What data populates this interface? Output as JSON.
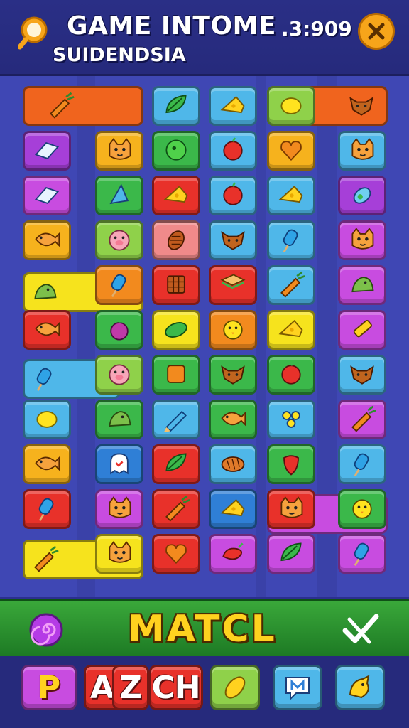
{
  "header": {
    "title": "GAME INTOME",
    "subtitle": "SUIDENDSIA",
    "timer": ".3:909"
  },
  "board": {
    "rows": [
      [
        {
          "color": "#4fb7e9",
          "icon": "leaf-icon"
        },
        {
          "color": "#4fb7e9",
          "icon": "cheese-icon"
        },
        {
          "color": "#8fd14a",
          "icon": "lemon-icon"
        }
      ],
      [
        {
          "color": "#a63fd8",
          "icon": "eraser-icon"
        },
        {
          "color": "#f6b21d",
          "icon": "cat-face-icon"
        },
        {
          "color": "#3bb84a",
          "icon": "melon-icon"
        },
        {
          "color": "#4fb7e9",
          "icon": "apple-icon"
        },
        {
          "color": "#f6b21d",
          "icon": "heart-icon"
        },
        {
          "color": "#4fb7e9",
          "icon": "cat-face-icon"
        }
      ],
      [
        {
          "color": "#c84ce0",
          "icon": "eraser-icon"
        },
        {
          "color": "#3bb84a",
          "icon": "cone-icon"
        },
        {
          "color": "#e8312a",
          "icon": "cheese-icon"
        },
        {
          "color": "#4fb7e9",
          "icon": "apple-icon"
        },
        {
          "color": "#4fb7e9",
          "icon": "cheese-icon"
        },
        {
          "color": "#a63fd8",
          "icon": "potion-icon"
        }
      ],
      [
        {
          "color": "#f6b21d",
          "icon": "fish-icon"
        },
        {
          "color": "#8fd14a",
          "icon": "pig-face-icon"
        },
        {
          "color": "#f08a8a",
          "icon": "pinecone-icon"
        },
        {
          "color": "#4fb7e9",
          "icon": "fox-face-icon"
        },
        {
          "color": "#4fb7e9",
          "icon": "popsicle-icon"
        },
        {
          "color": "#c84ce0",
          "icon": "cat-face-icon"
        }
      ],
      [
        {
          "color": "#f28a1e",
          "icon": "popsicle-icon"
        },
        {
          "color": "#e8312a",
          "icon": "chocolate-icon"
        },
        {
          "color": "#e8312a",
          "icon": "sandwich-icon"
        },
        {
          "color": "#4fb7e9",
          "icon": "carrot-icon"
        },
        {
          "color": "#c84ce0",
          "icon": "dino-icon"
        }
      ],
      [
        {
          "color": "#e8312a",
          "icon": "fish-icon"
        },
        {
          "color": "#3bb84a",
          "icon": "plum-icon"
        },
        {
          "color": "#f6e31d",
          "icon": "pickle-icon"
        },
        {
          "color": "#f28a1e",
          "icon": "chick-icon"
        },
        {
          "color": "#f6e31d",
          "icon": "cheese-icon"
        },
        {
          "color": "#c84ce0",
          "icon": "crayon-icon"
        }
      ],
      [
        {
          "color": "#8fd14a",
          "icon": "pig-face-icon"
        },
        {
          "color": "#3bb84a",
          "icon": "toast-icon"
        },
        {
          "color": "#3bb84a",
          "icon": "fox-face-icon"
        },
        {
          "color": "#3bb84a",
          "icon": "apple-icon"
        },
        {
          "color": "#4fb7e9",
          "icon": "fox-face-icon"
        }
      ],
      [
        {
          "color": "#4fb7e9",
          "icon": "lemon-icon"
        },
        {
          "color": "#3bb84a",
          "icon": "dino-icon"
        },
        {
          "color": "#4fb7e9",
          "icon": "pencil-icon"
        },
        {
          "color": "#3bb84a",
          "icon": "fish-icon"
        },
        {
          "color": "#4fb7e9",
          "icon": "grapes-icon"
        },
        {
          "color": "#c84ce0",
          "icon": "carrot-icon"
        }
      ],
      [
        {
          "color": "#f6b21d",
          "icon": "fish-icon"
        },
        {
          "color": "#2f7fd6",
          "icon": "ghost-icon"
        },
        {
          "color": "#e8312a",
          "icon": "leaf-icon"
        },
        {
          "color": "#4fb7e9",
          "icon": "bread-icon"
        },
        {
          "color": "#3bb84a",
          "icon": "strawberry-icon"
        },
        {
          "color": "#4fb7e9",
          "icon": "popsicle-icon"
        }
      ],
      [
        {
          "color": "#e8312a",
          "icon": "popsicle-icon"
        },
        {
          "color": "#c84ce0",
          "icon": "cat-face-icon"
        },
        {
          "color": "#e8312a",
          "icon": "carrot-icon"
        },
        {
          "color": "#2f7fd6",
          "icon": "cheese-icon"
        },
        {
          "color": "#e8312a",
          "icon": "cat-face-icon"
        },
        {
          "color": "#3bb84a",
          "icon": "chick-icon"
        }
      ],
      [
        {
          "color": "#f6e31d",
          "icon": "cat-face-icon"
        },
        {
          "color": "#e8312a",
          "icon": "heart-icon"
        },
        {
          "color": "#c84ce0",
          "icon": "pepper-icon"
        },
        {
          "color": "#c84ce0",
          "icon": "leaf-icon"
        },
        {
          "color": "#c84ce0",
          "icon": "popsicle-icon"
        }
      ]
    ]
  },
  "footer": {
    "match_label": "MATCL",
    "letter_tiles": [
      "P",
      "A",
      "Z",
      "CH"
    ]
  }
}
